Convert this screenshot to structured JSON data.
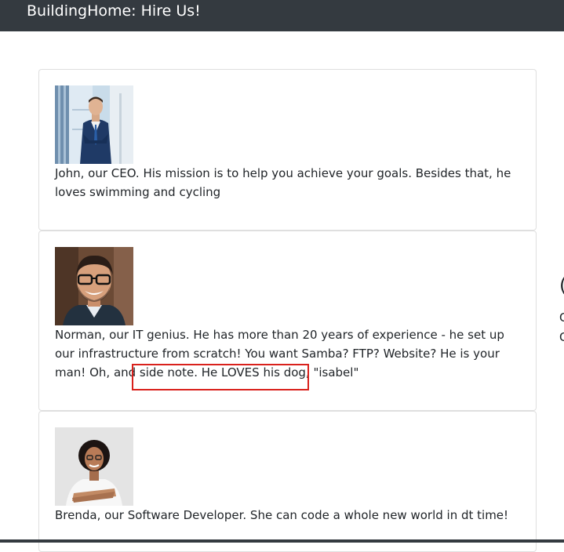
{
  "navbar": {
    "brand": "BuildingHome: Hire Us!"
  },
  "team": [
    {
      "photo_icon": "ceo-portrait-photo",
      "description": "John, our CEO. His mission is to help you achieve your goals. Besides that, he loves swimming and cycling"
    },
    {
      "photo_icon": "it-genius-portrait-photo",
      "description_main": "Norman, our IT genius. He has more than 20 years of experience - he set up our infrastructure from scratch! You want Samba? FTP? Website? He is your man! Oh, and side note.",
      "description_highlight": "He LOVES his dog, \"isabel\""
    },
    {
      "photo_icon": "developer-portrait-photo",
      "description": "Brenda, our Software Developer. She can code a whole new world in dt time!"
    }
  ],
  "colors": {
    "navbar": "#343a40",
    "highlight_box": "#d9211c",
    "text": "#212529"
  }
}
